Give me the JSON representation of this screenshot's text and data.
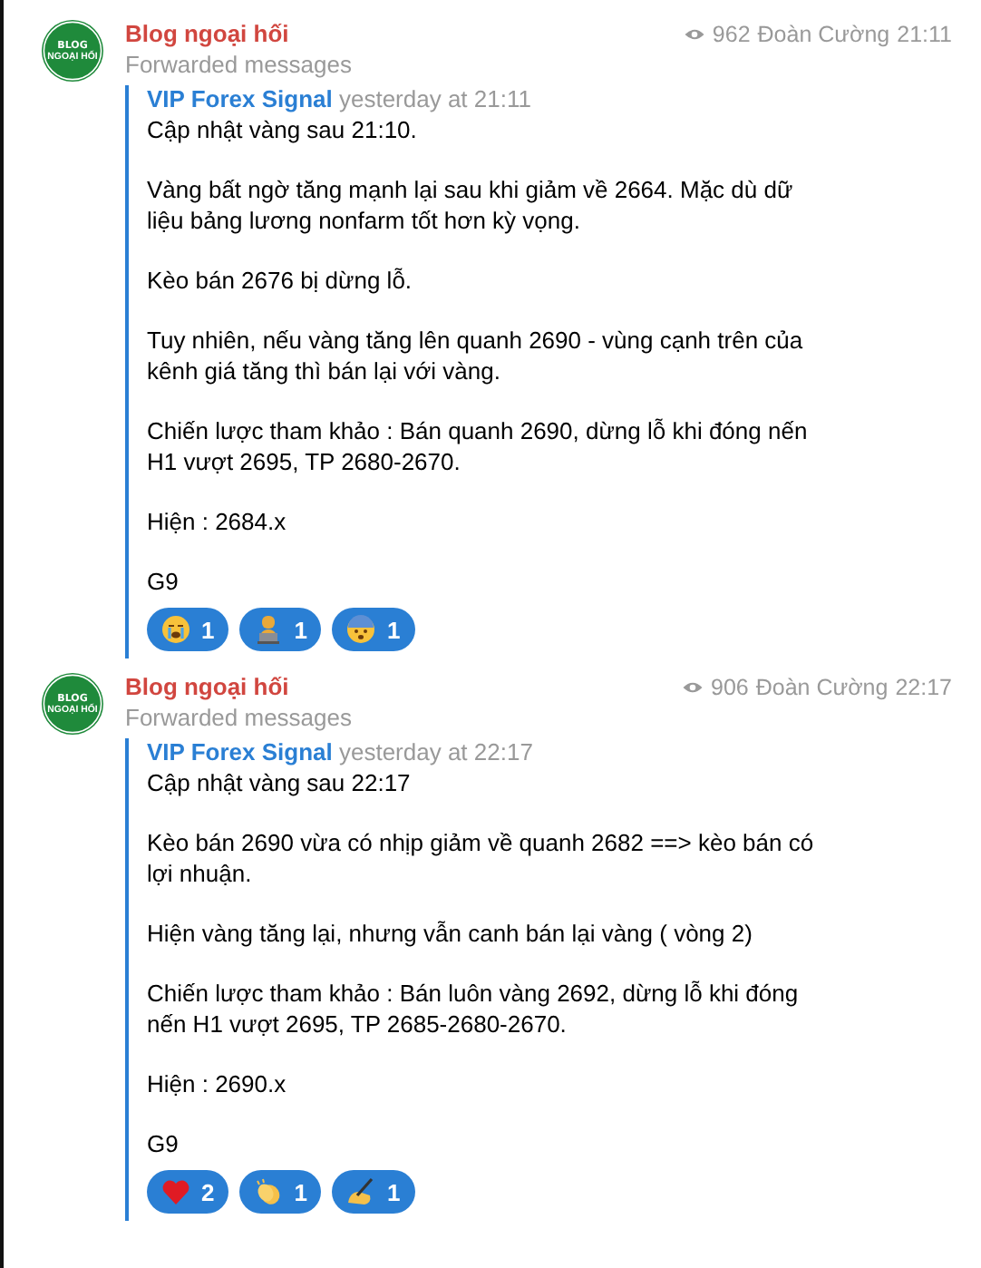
{
  "messages": [
    {
      "channel": "Blog ngoại hối",
      "avatar_text": [
        "BLOG",
        "NGOẠI HỐI"
      ],
      "subtitle": "Forwarded messages",
      "views": "962",
      "author": "Đoàn Cường",
      "time": "21:11",
      "forward_from": "VIP Forex Signal",
      "forward_time": "yesterday at 21:11",
      "paragraphs": [
        "Cập nhật vàng sau 21:10.",
        "Vàng bất ngờ tăng mạnh lại sau khi giảm về 2664. Mặc dù dữ liệu bảng lương nonfarm tốt hơn kỳ vọng.",
        "Kèo bán 2676 bị dừng lỗ.",
        "Tuy nhiên, nếu vàng tăng lên quanh 2690 - vùng cạnh trên của kênh giá tăng thì bán lại với vàng.",
        "Chiến lược tham khảo : Bán quanh 2690, dừng lỗ khi đóng nến H1 vượt 2695, TP 2680-2670.",
        "Hiện : 2684.x",
        "G9"
      ],
      "reactions": [
        {
          "kind": "crying",
          "count": "1"
        },
        {
          "kind": "technologist",
          "count": "1"
        },
        {
          "kind": "fearful",
          "count": "1"
        }
      ]
    },
    {
      "channel": "Blog ngoại hối",
      "avatar_text": [
        "BLOG",
        "NGOẠI HỐI"
      ],
      "subtitle": "Forwarded messages",
      "views": "906",
      "author": "Đoàn Cường",
      "time": "22:17",
      "forward_from": "VIP Forex Signal",
      "forward_time": "yesterday at 22:17",
      "paragraphs": [
        "Cập nhật vàng sau 22:17",
        "Kèo bán 2690 vừa có nhịp giảm về quanh 2682 ==> kèo bán có lợi nhuận.",
        "Hiện vàng tăng lại, nhưng vẫn canh bán lại vàng ( vòng 2)",
        "Chiến lược tham khảo : Bán luôn vàng 2692, dừng lỗ khi đóng nến H1 vượt 2695, TP 2685-2680-2670.",
        "Hiện : 2690.x",
        "G9"
      ],
      "reactions": [
        {
          "kind": "heart",
          "count": "2"
        },
        {
          "kind": "clap",
          "count": "1"
        },
        {
          "kind": "writing",
          "count": "1"
        }
      ]
    }
  ]
}
